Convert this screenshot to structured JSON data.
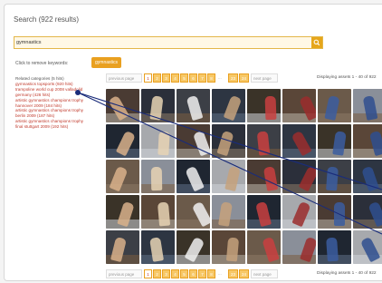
{
  "search": {
    "title": "Search (922 results)",
    "query": "gymnastics"
  },
  "keywords": {
    "remove_label": "Click to remove keywords:",
    "chips": [
      "gymnastics"
    ]
  },
  "related": {
    "heading": "Related categories (5 hits)",
    "items": [
      "gymnastics topsports (920 hits)",
      "trampoline world cup 2008 valladolid",
      "germany (426 hits)",
      "artistic gymnastics champions trophy",
      "hannover 2009 (184 hits)",
      "artistic gymnastics champions trophy",
      "berlin 2009 (187 hits)",
      "artistic gymnastics champions trophy",
      "final stuttgart 2009 (192 hits)"
    ]
  },
  "pager": {
    "prev": "previous page",
    "pages": [
      "1",
      "2",
      "3",
      "4",
      "5",
      "6",
      "7",
      "8"
    ],
    "dots": "...",
    "last_pages": [
      "23",
      "24"
    ],
    "next": "next page",
    "current": "1"
  },
  "display": {
    "top": "Displaying assets 1 - 40 of 922",
    "bottom": "Displaying assets 1 - 40 of 922"
  },
  "colors": {
    "accent": "#e9a020",
    "link": "#c0392b",
    "connector": "#1a2c7a"
  }
}
